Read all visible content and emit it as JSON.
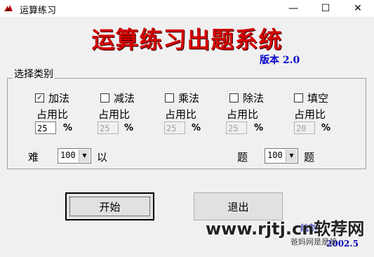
{
  "window": {
    "title": "运算练习",
    "icon": "bird-icon",
    "controls": {
      "minimize": "—",
      "maximize": "☐",
      "close": "✕"
    }
  },
  "header": {
    "title": "运算练习出题系统",
    "version": "版本 2.0"
  },
  "options": {
    "group_label": "选择类别",
    "ratio_label": "占用比",
    "percent_sign": "%",
    "categories": [
      {
        "label": "加法",
        "checked": true,
        "ratio": "25"
      },
      {
        "label": "减法",
        "checked": false,
        "ratio": "25"
      },
      {
        "label": "乘法",
        "checked": false,
        "ratio": "25"
      },
      {
        "label": "除法",
        "checked": false,
        "ratio": "25"
      },
      {
        "label": "填空",
        "checked": false,
        "ratio": "20"
      }
    ],
    "difficulty_prefix": "难",
    "difficulty_value": "100",
    "difficulty_suffix": "以",
    "count_prefix": "题",
    "count_value": "100",
    "count_suffix": "题"
  },
  "buttons": {
    "start": "开始",
    "exit": "退出"
  },
  "footer": {
    "author_partial": "编制",
    "date": "2002.5"
  },
  "watermark": {
    "main": "www.rjtj.cn软荐网",
    "sub": "爸妈网是是爸"
  },
  "colors": {
    "title_red": "#d40000",
    "version_blue": "#0000c8",
    "dialog_bg": "#f0f0f0"
  }
}
